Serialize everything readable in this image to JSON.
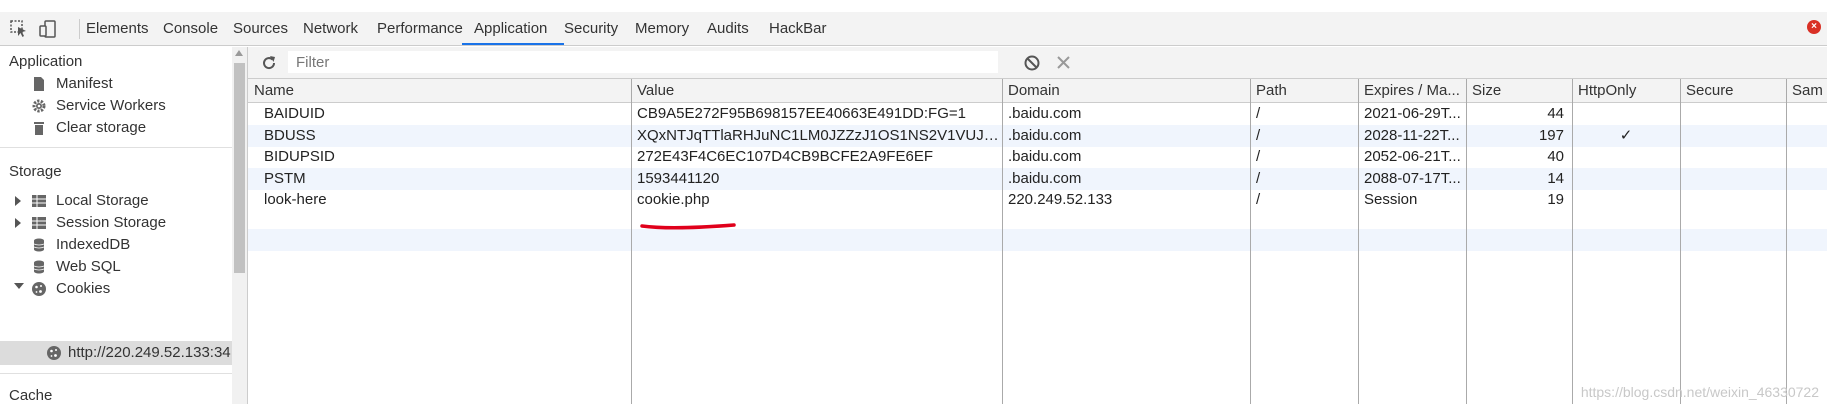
{
  "tabs": [
    "Elements",
    "Console",
    "Sources",
    "Network",
    "Performance",
    "Application",
    "Security",
    "Memory",
    "Audits",
    "HackBar"
  ],
  "active_tab": "Application",
  "sidebar": {
    "application_title": "Application",
    "application_items": [
      "Manifest",
      "Service Workers",
      "Clear storage"
    ],
    "storage_title": "Storage",
    "storage_items": [
      "Local Storage",
      "Session Storage",
      "IndexedDB",
      "Web SQL",
      "Cookies"
    ],
    "cookie_origin": "http://220.249.52.133:34",
    "cache_title": "Cache"
  },
  "filter": {
    "placeholder": "Filter"
  },
  "table": {
    "columns": [
      "Name",
      "Value",
      "Domain",
      "Path",
      "Expires / Ma...",
      "Size",
      "HttpOnly",
      "Secure",
      "Sam"
    ],
    "rows": [
      {
        "name": "BAIDUID",
        "value": "CB9A5E272F95B698157EE40663E491DD:FG=1",
        "domain": ".baidu.com",
        "path": "/",
        "expires": "2021-06-29T...",
        "size": "44",
        "httponly": "",
        "secure": ""
      },
      {
        "name": "BDUSS",
        "value": "XQxNTJqTTlaRHJuNC1LM0JZZzJ1OS1NS2V1VUJMSX...",
        "domain": ".baidu.com",
        "path": "/",
        "expires": "2028-11-22T...",
        "size": "197",
        "httponly": "✓",
        "secure": ""
      },
      {
        "name": "BIDUPSID",
        "value": "272E43F4C6EC107D4CB9BCFE2A9FE6EF",
        "domain": ".baidu.com",
        "path": "/",
        "expires": "2052-06-21T...",
        "size": "40",
        "httponly": "",
        "secure": ""
      },
      {
        "name": "PSTM",
        "value": "1593441120",
        "domain": ".baidu.com",
        "path": "/",
        "expires": "2088-07-17T...",
        "size": "14",
        "httponly": "",
        "secure": ""
      },
      {
        "name": "look-here",
        "value": "cookie.php",
        "domain": "220.249.52.133",
        "path": "/",
        "expires": "Session",
        "size": "19",
        "httponly": "",
        "secure": ""
      }
    ]
  },
  "watermark": "https://blog.csdn.net/weixin_46330722",
  "colors": {
    "accent": "#1a73e8",
    "annotation": "#e0001b",
    "close": "#d93025"
  }
}
